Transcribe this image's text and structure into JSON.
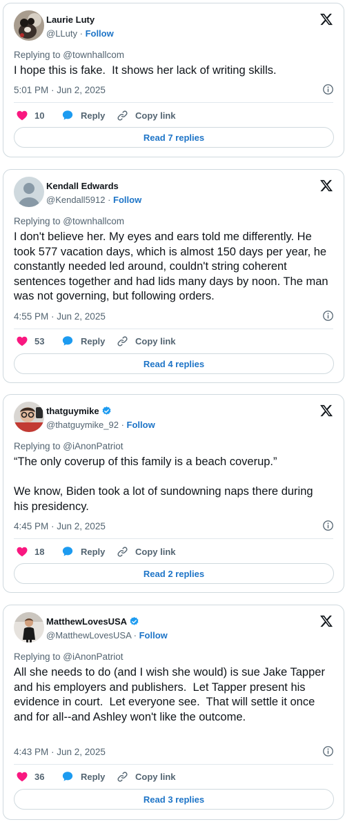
{
  "accent_color": "#1d74c7",
  "like_color": "#f91880",
  "reply_icon_color": "#1d9bf0",
  "tweets": [
    {
      "display_name": "Laurie Luty",
      "handle": "@LLuty",
      "follow_label": "Follow",
      "verified": false,
      "replying_to": "Replying to @townhallcom",
      "text": "I hope this is fake.  It shows her lack of writing skills.",
      "timestamp": "5:01 PM · Jun 2, 2025",
      "likes": "10",
      "reply_label": "Reply",
      "copy_label": "Copy link",
      "read_replies": "Read 7 replies"
    },
    {
      "display_name": "Kendall Edwards",
      "handle": "@Kendall5912",
      "follow_label": "Follow",
      "verified": false,
      "replying_to": "Replying to @townhallcom",
      "text": "I don't believe her. My eyes and ears told me differently. He took 577 vacation days, which is almost 150 days per year, he constantly needed led around, couldn't string coherent sentences together and had lids many days by noon. The man was not governing, but following orders.",
      "timestamp": "4:55 PM · Jun 2, 2025",
      "likes": "53",
      "reply_label": "Reply",
      "copy_label": "Copy link",
      "read_replies": "Read 4 replies"
    },
    {
      "display_name": "thatguymike",
      "handle": "@thatguymike_92",
      "follow_label": "Follow",
      "verified": true,
      "replying_to": "Replying to @iAnonPatriot",
      "text": "“The only coverup of this family is a beach coverup.”\n\nWe know, Biden took a lot of sundowning naps there during his presidency.",
      "timestamp": "4:45 PM · Jun 2, 2025",
      "likes": "18",
      "reply_label": "Reply",
      "copy_label": "Copy link",
      "read_replies": "Read 2 replies"
    },
    {
      "display_name": "MatthewLovesUSA",
      "handle": "@MatthewLovesUSA",
      "follow_label": "Follow",
      "verified": true,
      "replying_to": "Replying to @iAnonPatriot",
      "text": "All she needs to do (and I wish she would) is sue Jake Tapper and his employers and publishers.  Let Tapper present his evidence in court.  Let everyone see.  That will settle it once and for all--and Ashley won't like the outcome.",
      "timestamp": "4:43 PM · Jun 2, 2025",
      "likes": "36",
      "reply_label": "Reply",
      "copy_label": "Copy link",
      "read_replies": "Read 3 replies"
    }
  ]
}
